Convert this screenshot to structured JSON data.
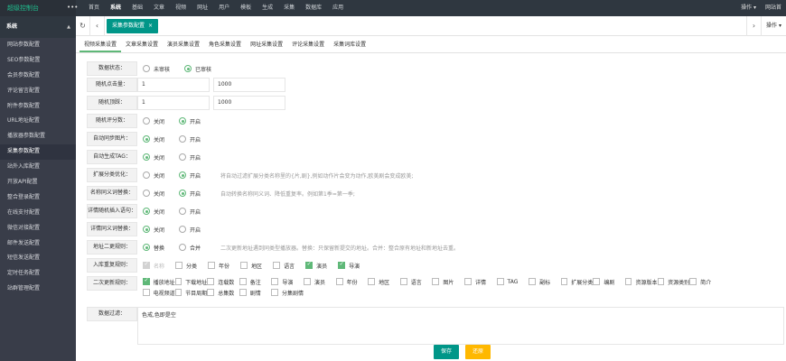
{
  "app": {
    "title": "超级控制台",
    "dots": "•••"
  },
  "topnav": [
    "首页",
    "系统",
    "基础",
    "文章",
    "视频",
    "网址",
    "用户",
    "模板",
    "生成",
    "采集",
    "数据库",
    "应用"
  ],
  "topnav_active": 1,
  "topright": [
    "操作 ▾",
    "网站首"
  ],
  "sidebar": {
    "header": "系统",
    "caret": "▲",
    "items": [
      "网站参数配置",
      "SEO参数配置",
      "会员参数配置",
      "评论留言配置",
      "附件参数配置",
      "URL地址配置",
      "播放器参数配置",
      "采集参数配置",
      "站外入库配置",
      "开放API配置",
      "整合登录配置",
      "在线支付配置",
      "微信对接配置",
      "邮件发送配置",
      "短信发送配置",
      "定时任务配置",
      "站群管理配置"
    ],
    "active": 7
  },
  "tabbar": {
    "refresh": "↻",
    "back": "‹",
    "active_tab": "采集参数配置",
    "close": "×",
    "forward": "›",
    "ops": "操作 ▾"
  },
  "subtabs": [
    "视频采集设置",
    "文章采集设置",
    "演员采集设置",
    "角色采集设置",
    "网址采集设置",
    "评论采集设置",
    "采集词库设置"
  ],
  "subtab_active": 0,
  "form": {
    "status": {
      "label": "数据状态：",
      "options": [
        "未审核",
        "已审核"
      ],
      "selected": 1
    },
    "hits": {
      "label": "随机点击量：",
      "min": "1",
      "max": "1000"
    },
    "likes": {
      "label": "随机顶踩：",
      "min": "1",
      "max": "1000"
    },
    "score": {
      "label": "随机评分数：",
      "options": [
        "关闭",
        "开启"
      ],
      "selected": 1
    },
    "sync_pic": {
      "label": "自动同步图片：",
      "options": [
        "关闭",
        "开启"
      ],
      "selected": 0
    },
    "auto_tag": {
      "label": "自动生成TAG：",
      "options": [
        "关闭",
        "开启"
      ],
      "selected": 0
    },
    "class_opt": {
      "label": "扩展分类优化：",
      "options": [
        "关闭",
        "开启"
      ],
      "selected": 1,
      "hint": "将自动过滤扩展分类名称里的{片,剧},例如动作片会变为动作,欧美剧会变成欧美;"
    },
    "name_syn": {
      "label": "名称同义词替换：",
      "options": [
        "关闭",
        "开启"
      ],
      "selected": 1,
      "hint": "自动转换名称同义词、降低重复率。例如第1季=第一季;"
    },
    "detail_rand": {
      "label": "详情随机插入语句：",
      "options": [
        "关闭",
        "开启"
      ],
      "selected": 0
    },
    "detail_syn": {
      "label": "详情同义词替换：",
      "options": [
        "关闭",
        "开启"
      ],
      "selected": 0
    },
    "play_url": {
      "label": "地址二更规则：",
      "options": [
        "替换",
        "合并"
      ],
      "selected": 0,
      "hint": "二次更新地址遇到同类型播放器。替换：只保留新提交的地址。合并：整合原有地址和新地址去重。"
    },
    "dup_rule": {
      "label": "入库重复规则：",
      "items": [
        {
          "t": "名称",
          "s": "dis"
        },
        {
          "t": "分类",
          "s": "off"
        },
        {
          "t": "年份",
          "s": "off"
        },
        {
          "t": "地区",
          "s": "off"
        },
        {
          "t": "语言",
          "s": "off"
        },
        {
          "t": "演员",
          "s": "on"
        },
        {
          "t": "导演",
          "s": "on"
        }
      ]
    },
    "update_rule": {
      "label": "二次更新规则：",
      "line1": [
        {
          "t": "播放地址",
          "s": "on"
        },
        {
          "t": "下载地址",
          "s": "off"
        },
        {
          "t": "连载数",
          "s": "off"
        },
        {
          "t": "备注",
          "s": "off"
        },
        {
          "t": "导演",
          "s": "off"
        },
        {
          "t": "演员",
          "s": "off"
        },
        {
          "t": "年份",
          "s": "off"
        },
        {
          "t": "地区",
          "s": "off"
        },
        {
          "t": "语言",
          "s": "off"
        },
        {
          "t": "图片",
          "s": "off"
        },
        {
          "t": "详情",
          "s": "off"
        },
        {
          "t": "TAG",
          "s": "off"
        },
        {
          "t": "副标",
          "s": "off"
        },
        {
          "t": "扩展分类",
          "s": "off"
        },
        {
          "t": "编剧",
          "s": "off"
        },
        {
          "t": "资源版本",
          "s": "off"
        },
        {
          "t": "资源类别",
          "s": "off"
        },
        {
          "t": "简介",
          "s": "off"
        }
      ],
      "line2": [
        {
          "t": "电视频道",
          "s": "off"
        },
        {
          "t": "节目周期",
          "s": "off"
        },
        {
          "t": "总集数",
          "s": "off"
        },
        {
          "t": "剧情",
          "s": "off"
        },
        {
          "t": "分集剧情",
          "s": "off"
        }
      ]
    },
    "filter": {
      "label": "数据过滤：",
      "value": "色戒,色即是空"
    }
  },
  "buttons": {
    "save": "保存",
    "reset": "还原"
  }
}
